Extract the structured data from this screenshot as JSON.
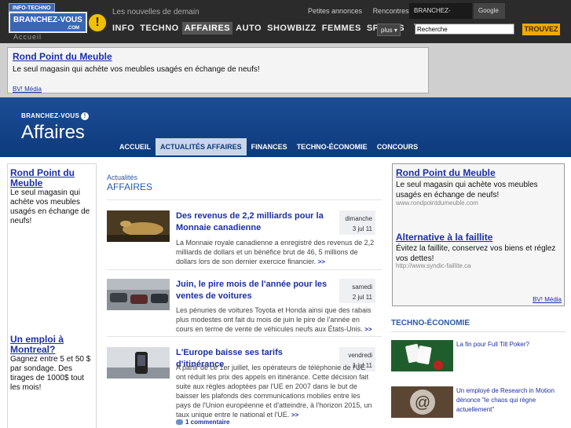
{
  "site": {
    "logo_tag": "INFO-TECHNO",
    "logo_name": "BRANCHEZ-VOUS",
    "logo_dotcom": ".COM",
    "logo_mark": "!",
    "accueil": "Accueil",
    "tagline": "Les nouvelles de demain",
    "toplinks": [
      "Petites annonces",
      "Rencontres"
    ],
    "search_tabs": [
      "BRANCHEZ-VOUS!",
      "Google"
    ],
    "nav": [
      "INFO",
      "TECHNO",
      "AFFAIRES",
      "AUTO",
      "SHOWBIZZ",
      "FEMMES",
      "SPORTS"
    ],
    "nav_active": "AFFAIRES",
    "plus_label": "plus",
    "search_value": "Recherche",
    "search_button": "TROUVEZ"
  },
  "top_ad": {
    "title": "Rond Point du Meuble",
    "desc": "Le seul magasin qui achète vos meubles usagés en échange de neufs!",
    "source": "BV! Média"
  },
  "affaires_header": {
    "brand_small": "BRANCHEZ-VOUS",
    "brand_mark": "!",
    "brand_big": "Affaires",
    "subnav": [
      "ACCUEIL",
      "ACTUALITÉS AFFAIRES",
      "FINANCES",
      "TECHNO-ÉCONOMIE",
      "CONCOURS"
    ],
    "subnav_active": "ACTUALITÉS AFFAIRES"
  },
  "left_ads": [
    {
      "title": "Rond Point du Meuble",
      "desc": "Le seul magasin qui achète vos meubles usagés en échange de neufs!"
    },
    {
      "title": "Un emploi à Montreal?",
      "desc": "Gagnez entre 5 et 50 $ par sondage. Des tirages de 1000$ tout les mois!"
    }
  ],
  "main": {
    "section_sup": "Actualités",
    "section_title": "AFFAIRES",
    "more_label": ">>",
    "articles": [
      {
        "title": "Des revenus de 2,2 milliards pour la Monnaie canadienne",
        "day": "dimanche",
        "date": "3 jul 11",
        "summary": "La Monnaie royale canadienne a enregistré des revenus de 2,2 milliards de dollars et un bénéfice brut de 46, 5 millions de dollars lors de son dernier exercice financier."
      },
      {
        "title": "Juin, le pire mois de l'année pour les ventes de voitures",
        "day": "samedi",
        "date": "2 jul 11",
        "summary": "Les pénuries de voitures Toyota et Honda ainsi que des rabais plus modestes ont fait du mois de juin le pire de l'année en cours en terme de vente de véhicules neufs aux États-Unis."
      },
      {
        "title": "L'Europe baisse ses tarifs d'itinérance",
        "day": "vendredi",
        "date": "1 jul 11",
        "summary": "A partir de ce 1er juillet, les opérateurs de téléphonie de l'UE ont réduit les prix des appels en itinérance. Cette décision fait suite aux règles adoptées par l'UE en 2007 dans le but de baisser les plafonds des communications mobiles entre les pays de l'Union européenne et d'atteindre, à l'horizon 2015, un taux unique entre le national et l'UE.",
        "comments": "1 commentaire"
      }
    ]
  },
  "right_ads": [
    {
      "title": "Rond Point du Meuble",
      "desc": "Le seul magasin qui achète vos meubles usagés en échange de neufs!",
      "url": "www.rondpointdumeuble.com"
    },
    {
      "title": "Alternative à la faillite",
      "desc": "Évitez la faillite, conservez vos biens et réglez vos dettes!",
      "url": "http://www.syndic-faillite.ca"
    }
  ],
  "right_ads_source": "BV! Média",
  "techno": {
    "title": "TECHNO-ÉCONOMIE",
    "items": [
      {
        "text": "La fin pour Full Tilt Poker?"
      },
      {
        "text": "Un employé de Research in Motion dénonce \"le chaos qui règne actuellement\""
      }
    ]
  },
  "colors": {
    "link_blue": "#1c2fa8",
    "header_blue": "#1c4d95",
    "find_button": "#f2a900"
  }
}
